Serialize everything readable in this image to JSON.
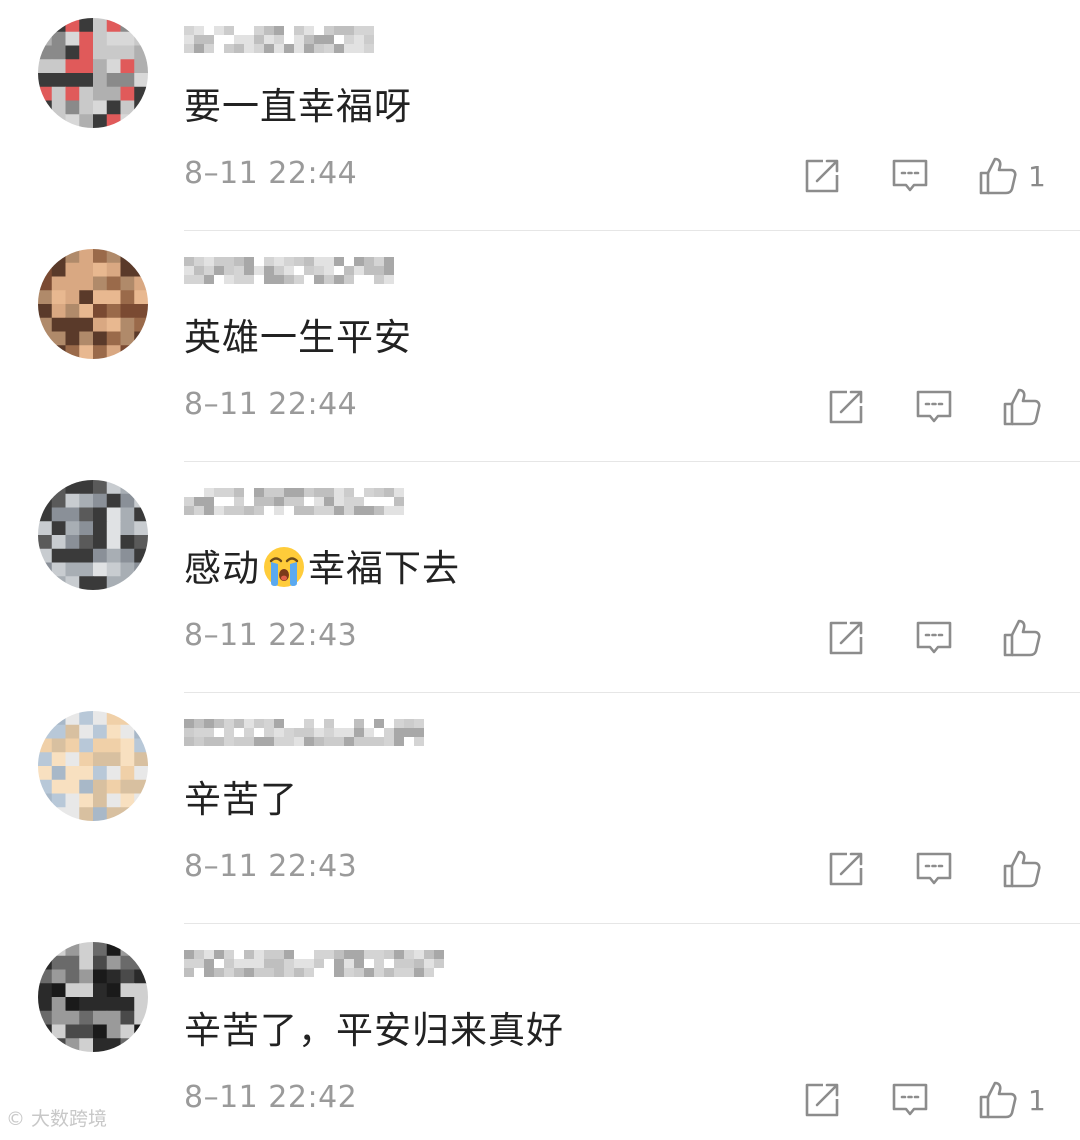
{
  "comments": [
    {
      "text": "要一直幸福呀",
      "time": "8–11 22:44",
      "like_count": "1",
      "avatar_colors": [
        "#c9c9c9",
        "#8a8a8a",
        "#b0b0b0",
        "#3a3a3a",
        "#d8d8d8",
        "#e05a5a"
      ]
    },
    {
      "text": "英雄一生平安",
      "time": "8–11 22:44",
      "like_count": "",
      "avatar_colors": [
        "#b08a6a",
        "#7a4a32",
        "#d9a882",
        "#5a3a2a",
        "#e8b890",
        "#9a6a4a"
      ]
    },
    {
      "text_before": "感动",
      "text_after": "幸福下去",
      "time": "8–11 22:43",
      "like_count": "",
      "avatar_colors": [
        "#c8ccd0",
        "#3a3a3a",
        "#8a9098",
        "#e0e2e4",
        "#5a5a5a",
        "#a8aeb4"
      ]
    },
    {
      "text": "辛苦了",
      "time": "8–11 22:43",
      "like_count": "",
      "avatar_colors": [
        "#b8c8d8",
        "#f0d0a8",
        "#e8e8e8",
        "#d8c0a0",
        "#a8b8c8",
        "#f8e0c0"
      ]
    },
    {
      "text": "辛苦了，平安归来真好",
      "time": "8–11 22:42",
      "like_count": "1",
      "avatar_colors": [
        "#2a2a2a",
        "#6a6a6a",
        "#1a1a1a",
        "#9a9a9a",
        "#4a4a4a",
        "#d0d0d0"
      ]
    }
  ],
  "icons": {
    "repost": "repost-icon",
    "comment": "comment-icon",
    "like": "thumbs-up-icon"
  },
  "colors": {
    "text": "#222222",
    "meta": "#9a9a9a",
    "icon": "#8c8c8c",
    "divider": "#e6e6e6"
  },
  "watermark": "大数跨境"
}
